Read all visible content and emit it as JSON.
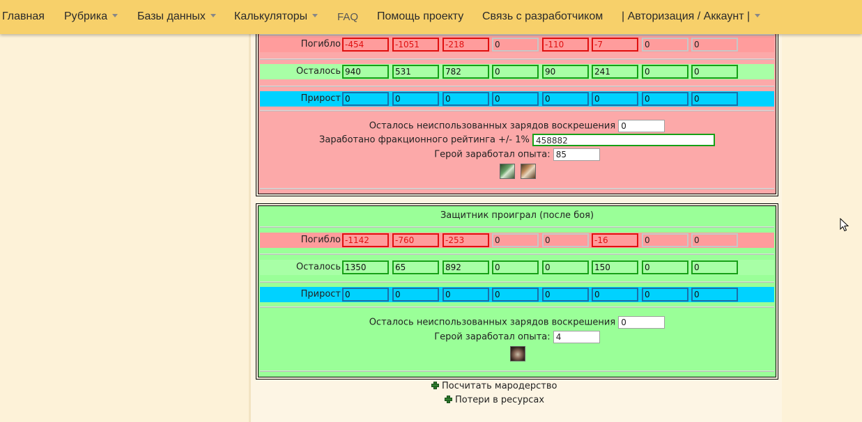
{
  "nav": {
    "items": [
      {
        "label": "Главная",
        "dropdown": false
      },
      {
        "label": "Рубрика",
        "dropdown": true
      },
      {
        "label": "Базы данных",
        "dropdown": true
      },
      {
        "label": "Калькуляторы",
        "dropdown": true
      },
      {
        "label": "FAQ",
        "dropdown": false
      },
      {
        "label": "Помощь проекту",
        "dropdown": false
      },
      {
        "label": "Связь с разработчиком",
        "dropdown": false
      },
      {
        "label": "| Авторизация / Аккаунт |",
        "dropdown": true
      }
    ]
  },
  "attacker": {
    "dead_label": "Погибло",
    "dead": [
      "-454",
      "-1051",
      "-218",
      "0",
      "-110",
      "-7",
      "0",
      "0"
    ],
    "alive_label": "Осталось",
    "alive": [
      "940",
      "531",
      "782",
      "0",
      "90",
      "241",
      "0",
      "0"
    ],
    "grow_label": "Прирост",
    "grow": [
      "0",
      "0",
      "0",
      "0",
      "0",
      "0",
      "0",
      "0"
    ],
    "res_label": "Осталось неиспользованных зарядов воскрешения",
    "res_value": "0",
    "rating_label": "Заработано фракционного рейтинга +/- 1%",
    "rating_value": "458882",
    "exp_label": "Герой заработал опыта:",
    "exp_value": "85",
    "skills": [
      "sword-skill-icon",
      "axe-skill-icon"
    ]
  },
  "defender": {
    "title": "Защитник проиграл (после боя)",
    "dead_label": "Погибло",
    "dead": [
      "-1142",
      "-760",
      "-253",
      "0",
      "0",
      "-16",
      "0",
      "0"
    ],
    "alive_label": "Осталось",
    "alive": [
      "1350",
      "65",
      "892",
      "0",
      "0",
      "150",
      "0",
      "0"
    ],
    "grow_label": "Прирост",
    "grow": [
      "0",
      "0",
      "0",
      "0",
      "0",
      "0",
      "0",
      "0"
    ],
    "res_label": "Осталось неиспользованных зарядов воскрешения",
    "res_value": "0",
    "exp_label": "Герой заработал опыта:",
    "exp_value": "4",
    "skills": [
      "creature-skill-icon"
    ]
  },
  "links": {
    "marauding": "Посчитать мародерство",
    "resources": "Потери в ресурсах"
  },
  "colors": {
    "nav_bg": "#f7d06a",
    "lose_panel": "#fca9a9",
    "win_panel": "#9aff98",
    "dead_row": "#ff9c9c",
    "alive_row": "#a8ffa6",
    "grow_row": "#00d2ff"
  }
}
